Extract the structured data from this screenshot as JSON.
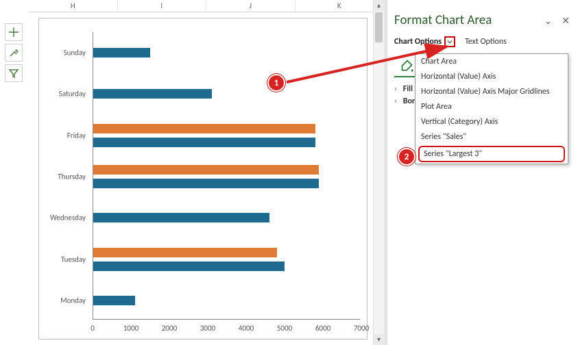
{
  "columns": [
    "H",
    "I",
    "J",
    "K"
  ],
  "pane": {
    "title": "Format Chart Area",
    "chart_options_label": "Chart Options",
    "text_options_label": "Text Options",
    "fill_label": "Fill",
    "border_label": "Border"
  },
  "dropdown": {
    "items": [
      "Chart Area",
      "Horizontal (Value) Axis",
      "Horizontal (Value) Axis Major Gridlines",
      "Plot Area",
      "Vertical (Category) Axis",
      "Series \"Sales\"",
      "Series \"Largest 3\""
    ],
    "highlighted_index": 6
  },
  "callouts": {
    "one": "1",
    "two": "2"
  },
  "chart_data": {
    "type": "bar",
    "orientation": "horizontal",
    "categories": [
      "Sunday",
      "Saturday",
      "Friday",
      "Thursday",
      "Wednesday",
      "Tuesday",
      "Monday"
    ],
    "xlim": [
      0,
      7000
    ],
    "xticks": [
      0,
      1000,
      2000,
      3000,
      4000,
      5000,
      6000,
      7000
    ],
    "series": [
      {
        "name": "Sales",
        "color": "#1f6b8f",
        "values": [
          1500,
          3100,
          5800,
          5900,
          4600,
          5000,
          1100
        ]
      },
      {
        "name": "Largest 3",
        "color": "#e07b33",
        "values": [
          null,
          null,
          5800,
          5900,
          null,
          4800,
          null
        ]
      }
    ]
  }
}
